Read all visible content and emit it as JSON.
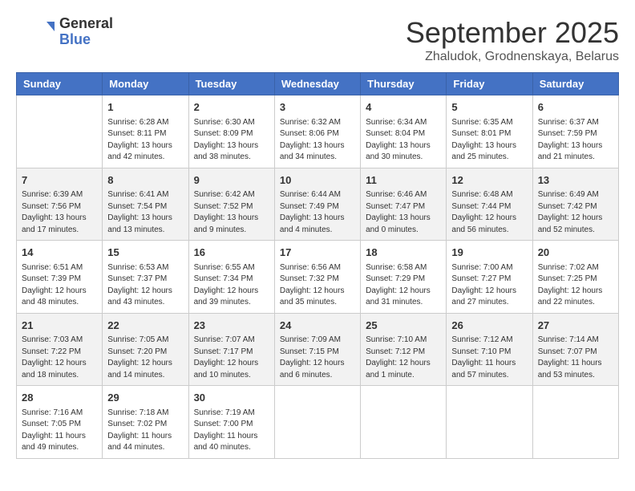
{
  "header": {
    "logo_line1": "General",
    "logo_line2": "Blue",
    "month": "September 2025",
    "location": "Zhaludok, Grodnenskaya, Belarus"
  },
  "days_of_week": [
    "Sunday",
    "Monday",
    "Tuesday",
    "Wednesday",
    "Thursday",
    "Friday",
    "Saturday"
  ],
  "weeks": [
    [
      {
        "day": "",
        "info": ""
      },
      {
        "day": "1",
        "info": "Sunrise: 6:28 AM\nSunset: 8:11 PM\nDaylight: 13 hours\nand 42 minutes."
      },
      {
        "day": "2",
        "info": "Sunrise: 6:30 AM\nSunset: 8:09 PM\nDaylight: 13 hours\nand 38 minutes."
      },
      {
        "day": "3",
        "info": "Sunrise: 6:32 AM\nSunset: 8:06 PM\nDaylight: 13 hours\nand 34 minutes."
      },
      {
        "day": "4",
        "info": "Sunrise: 6:34 AM\nSunset: 8:04 PM\nDaylight: 13 hours\nand 30 minutes."
      },
      {
        "day": "5",
        "info": "Sunrise: 6:35 AM\nSunset: 8:01 PM\nDaylight: 13 hours\nand 25 minutes."
      },
      {
        "day": "6",
        "info": "Sunrise: 6:37 AM\nSunset: 7:59 PM\nDaylight: 13 hours\nand 21 minutes."
      }
    ],
    [
      {
        "day": "7",
        "info": "Sunrise: 6:39 AM\nSunset: 7:56 PM\nDaylight: 13 hours\nand 17 minutes."
      },
      {
        "day": "8",
        "info": "Sunrise: 6:41 AM\nSunset: 7:54 PM\nDaylight: 13 hours\nand 13 minutes."
      },
      {
        "day": "9",
        "info": "Sunrise: 6:42 AM\nSunset: 7:52 PM\nDaylight: 13 hours\nand 9 minutes."
      },
      {
        "day": "10",
        "info": "Sunrise: 6:44 AM\nSunset: 7:49 PM\nDaylight: 13 hours\nand 4 minutes."
      },
      {
        "day": "11",
        "info": "Sunrise: 6:46 AM\nSunset: 7:47 PM\nDaylight: 13 hours\nand 0 minutes."
      },
      {
        "day": "12",
        "info": "Sunrise: 6:48 AM\nSunset: 7:44 PM\nDaylight: 12 hours\nand 56 minutes."
      },
      {
        "day": "13",
        "info": "Sunrise: 6:49 AM\nSunset: 7:42 PM\nDaylight: 12 hours\nand 52 minutes."
      }
    ],
    [
      {
        "day": "14",
        "info": "Sunrise: 6:51 AM\nSunset: 7:39 PM\nDaylight: 12 hours\nand 48 minutes."
      },
      {
        "day": "15",
        "info": "Sunrise: 6:53 AM\nSunset: 7:37 PM\nDaylight: 12 hours\nand 43 minutes."
      },
      {
        "day": "16",
        "info": "Sunrise: 6:55 AM\nSunset: 7:34 PM\nDaylight: 12 hours\nand 39 minutes."
      },
      {
        "day": "17",
        "info": "Sunrise: 6:56 AM\nSunset: 7:32 PM\nDaylight: 12 hours\nand 35 minutes."
      },
      {
        "day": "18",
        "info": "Sunrise: 6:58 AM\nSunset: 7:29 PM\nDaylight: 12 hours\nand 31 minutes."
      },
      {
        "day": "19",
        "info": "Sunrise: 7:00 AM\nSunset: 7:27 PM\nDaylight: 12 hours\nand 27 minutes."
      },
      {
        "day": "20",
        "info": "Sunrise: 7:02 AM\nSunset: 7:25 PM\nDaylight: 12 hours\nand 22 minutes."
      }
    ],
    [
      {
        "day": "21",
        "info": "Sunrise: 7:03 AM\nSunset: 7:22 PM\nDaylight: 12 hours\nand 18 minutes."
      },
      {
        "day": "22",
        "info": "Sunrise: 7:05 AM\nSunset: 7:20 PM\nDaylight: 12 hours\nand 14 minutes."
      },
      {
        "day": "23",
        "info": "Sunrise: 7:07 AM\nSunset: 7:17 PM\nDaylight: 12 hours\nand 10 minutes."
      },
      {
        "day": "24",
        "info": "Sunrise: 7:09 AM\nSunset: 7:15 PM\nDaylight: 12 hours\nand 6 minutes."
      },
      {
        "day": "25",
        "info": "Sunrise: 7:10 AM\nSunset: 7:12 PM\nDaylight: 12 hours\nand 1 minute."
      },
      {
        "day": "26",
        "info": "Sunrise: 7:12 AM\nSunset: 7:10 PM\nDaylight: 11 hours\nand 57 minutes."
      },
      {
        "day": "27",
        "info": "Sunrise: 7:14 AM\nSunset: 7:07 PM\nDaylight: 11 hours\nand 53 minutes."
      }
    ],
    [
      {
        "day": "28",
        "info": "Sunrise: 7:16 AM\nSunset: 7:05 PM\nDaylight: 11 hours\nand 49 minutes."
      },
      {
        "day": "29",
        "info": "Sunrise: 7:18 AM\nSunset: 7:02 PM\nDaylight: 11 hours\nand 44 minutes."
      },
      {
        "day": "30",
        "info": "Sunrise: 7:19 AM\nSunset: 7:00 PM\nDaylight: 11 hours\nand 40 minutes."
      },
      {
        "day": "",
        "info": ""
      },
      {
        "day": "",
        "info": ""
      },
      {
        "day": "",
        "info": ""
      },
      {
        "day": "",
        "info": ""
      }
    ]
  ]
}
